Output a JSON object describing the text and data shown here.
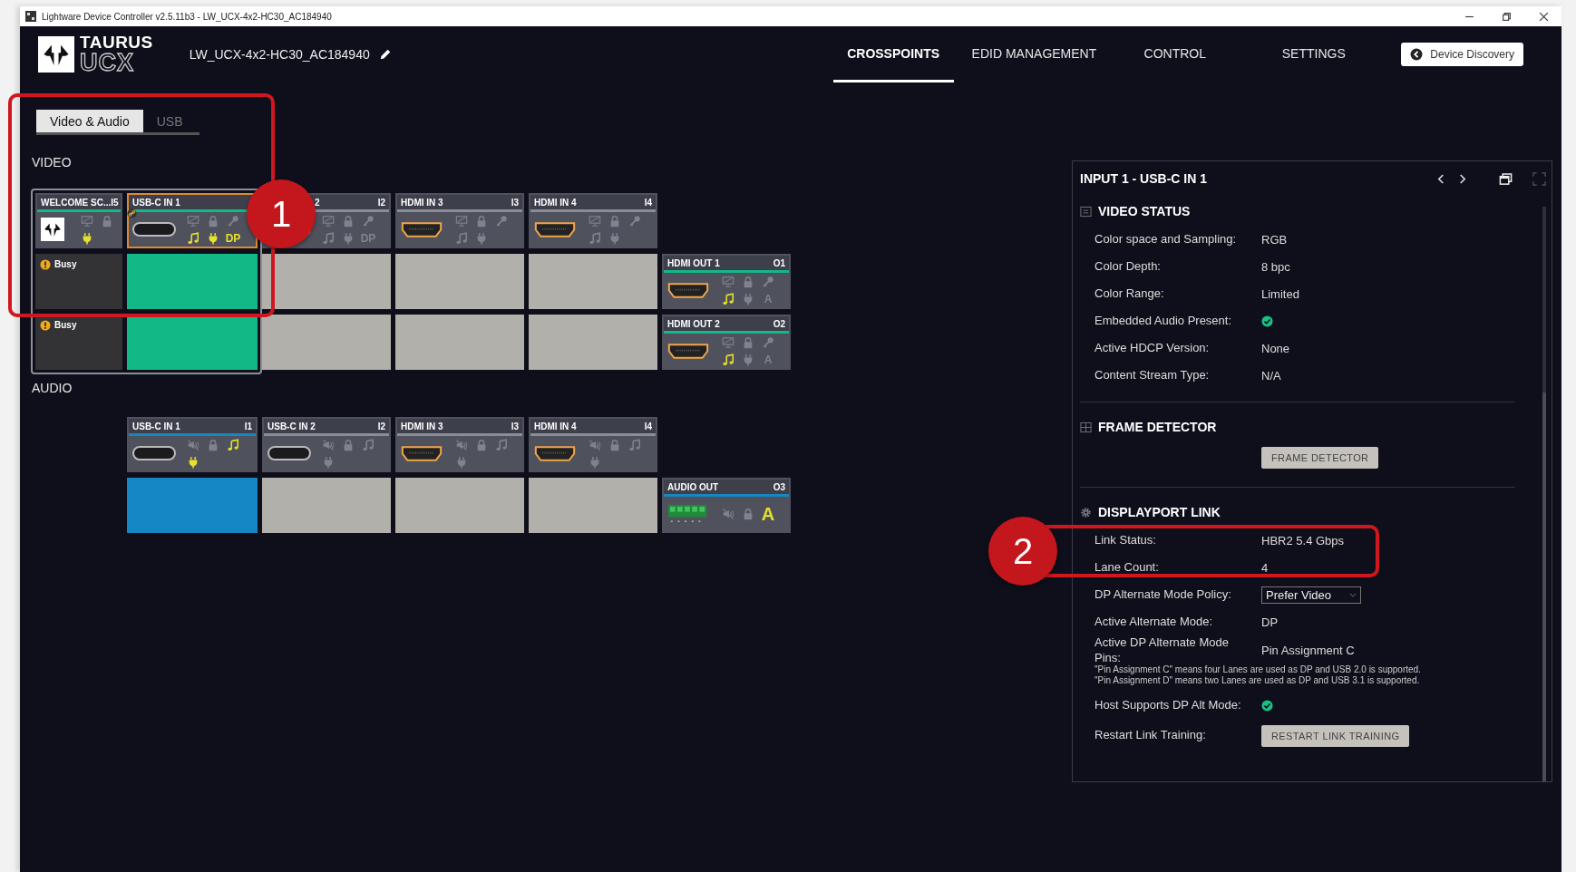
{
  "window": {
    "title": "Lightware Device Controller v2.5.11b3 - LW_UCX-4x2-HC30_AC184940"
  },
  "header": {
    "logo_top": "TAURUS",
    "logo_bottom": "UCX",
    "device_name": "LW_UCX-4x2-HC30_AC184940",
    "nav": [
      {
        "label": "CROSSPOINTS",
        "selected": true
      },
      {
        "label": "EDID MANAGEMENT",
        "selected": false
      },
      {
        "label": "CONTROL",
        "selected": false
      },
      {
        "label": "SETTINGS",
        "selected": false
      }
    ],
    "discovery_button": "Device Discovery"
  },
  "tabs": [
    {
      "label": "Video & Audio",
      "selected": true
    },
    {
      "label": "USB",
      "selected": false
    }
  ],
  "video": {
    "kind": "video",
    "label": "VIDEO",
    "inputs": [
      {
        "name": "WELCOME SC...",
        "port": "I5",
        "kind": "logo",
        "signal": true,
        "selected": false,
        "linked": false,
        "top": [
          {
            "kind": "monitor",
            "active": false
          },
          {
            "kind": "lock",
            "active": false
          }
        ],
        "bottom": [
          {
            "kind": "plug",
            "active": true
          }
        ]
      },
      {
        "name": "USB-C IN 1",
        "kind": "usbc",
        "signal": true,
        "selected": true,
        "linked": true,
        "top": [
          {
            "kind": "monitor",
            "active": false
          },
          {
            "kind": "lock",
            "active": false
          },
          {
            "kind": "key",
            "active": false
          }
        ],
        "bottom": [
          {
            "kind": "music",
            "active": true
          },
          {
            "kind": "plug",
            "active": true
          },
          {
            "kind": "text",
            "text": "DP",
            "active": true
          }
        ]
      },
      {
        "name": "2",
        "port": "I2",
        "kind": "usbc",
        "signal": false,
        "selected": false,
        "linked": false,
        "partly_hidden": true,
        "top": [
          {
            "kind": "monitor",
            "active": false
          },
          {
            "kind": "lock",
            "active": false
          },
          {
            "kind": "key",
            "active": false
          }
        ],
        "bottom": [
          {
            "kind": "music",
            "active": false
          },
          {
            "kind": "plug",
            "active": false
          },
          {
            "kind": "text",
            "text": "DP",
            "active": false
          }
        ]
      },
      {
        "name": "HDMI IN 3",
        "port": "I3",
        "kind": "hdmi",
        "signal": false,
        "selected": false,
        "linked": false,
        "top": [
          {
            "kind": "monitor",
            "active": false
          },
          {
            "kind": "lock",
            "active": false
          },
          {
            "kind": "key",
            "active": false
          }
        ],
        "bottom": [
          {
            "kind": "music",
            "active": false
          },
          {
            "kind": "plug",
            "active": false
          }
        ]
      },
      {
        "name": "HDMI IN 4",
        "port": "I4",
        "kind": "hdmi",
        "signal": false,
        "selected": false,
        "linked": false,
        "top": [
          {
            "kind": "monitor",
            "active": false
          },
          {
            "kind": "lock",
            "active": false
          },
          {
            "kind": "key",
            "active": false
          }
        ],
        "bottom": [
          {
            "kind": "music",
            "active": false
          },
          {
            "kind": "plug",
            "active": false
          }
        ]
      }
    ],
    "outputs": [
      {
        "name": "HDMI OUT 1",
        "port": "O1",
        "kind": "hdmi",
        "signal": true,
        "top": [
          {
            "kind": "monitor",
            "active": false
          },
          {
            "kind": "lock",
            "active": false
          },
          {
            "kind": "key",
            "active": false
          }
        ],
        "bottom": [
          {
            "kind": "music",
            "active": true
          },
          {
            "kind": "plug",
            "active": false
          },
          {
            "kind": "text",
            "text": "A",
            "active": false
          }
        ]
      },
      {
        "name": "HDMI OUT 2",
        "port": "O2",
        "kind": "hdmi",
        "signal": true,
        "top": [
          {
            "kind": "monitor",
            "active": false
          },
          {
            "kind": "lock",
            "active": false
          },
          {
            "kind": "key",
            "active": false
          }
        ],
        "bottom": [
          {
            "kind": "music",
            "active": true
          },
          {
            "kind": "plug",
            "active": false
          },
          {
            "kind": "text",
            "text": "A",
            "active": false
          }
        ]
      }
    ],
    "rows": [
      {
        "cells": [
          {
            "kind": "busy",
            "text": "Busy"
          },
          {
            "kind": "on"
          },
          {
            "kind": "off"
          },
          {
            "kind": "off"
          },
          {
            "kind": "off"
          }
        ]
      },
      {
        "cells": [
          {
            "kind": "busy",
            "text": "Busy"
          },
          {
            "kind": "on"
          },
          {
            "kind": "off"
          },
          {
            "kind": "off"
          },
          {
            "kind": "off"
          }
        ]
      }
    ]
  },
  "audio": {
    "kind": "audio",
    "label": "AUDIO",
    "inputs": [
      {
        "name": "USB-C IN 1",
        "port": "I1",
        "kind": "usbc",
        "signal": true,
        "selected": false,
        "linked": false,
        "top": [
          {
            "kind": "mute",
            "active": false
          },
          {
            "kind": "lock",
            "active": false
          },
          {
            "kind": "music",
            "active": true
          }
        ],
        "bottom": [
          {
            "kind": "plug",
            "active": true
          }
        ]
      },
      {
        "name": "USB-C IN 2",
        "port": "I2",
        "kind": "usbc",
        "signal": false,
        "selected": false,
        "linked": false,
        "top": [
          {
            "kind": "mute",
            "active": false
          },
          {
            "kind": "lock",
            "active": false
          },
          {
            "kind": "music",
            "active": false
          }
        ],
        "bottom": [
          {
            "kind": "plug",
            "active": false
          }
        ]
      },
      {
        "name": "HDMI IN 3",
        "port": "I3",
        "kind": "hdmi",
        "signal": false,
        "selected": false,
        "linked": false,
        "top": [
          {
            "kind": "mute",
            "active": false
          },
          {
            "kind": "lock",
            "active": false
          },
          {
            "kind": "music",
            "active": false
          }
        ],
        "bottom": [
          {
            "kind": "plug",
            "active": false
          }
        ]
      },
      {
        "name": "HDMI IN 4",
        "port": "I4",
        "kind": "hdmi",
        "signal": false,
        "selected": false,
        "linked": false,
        "top": [
          {
            "kind": "mute",
            "active": false
          },
          {
            "kind": "lock",
            "active": false
          },
          {
            "kind": "music",
            "active": false
          }
        ],
        "bottom": [
          {
            "kind": "plug",
            "active": false
          }
        ]
      }
    ],
    "outputs": [
      {
        "name": "AUDIO OUT",
        "port": "O3",
        "kind": "terminal",
        "signal": true,
        "top": [
          {
            "kind": "mute",
            "active": false
          },
          {
            "kind": "lock",
            "active": false
          },
          {
            "kind": "text",
            "text": "A",
            "active": true
          }
        ]
      }
    ],
    "rows": [
      {
        "cells": [
          {
            "kind": "on"
          },
          {
            "kind": "off"
          },
          {
            "kind": "off"
          },
          {
            "kind": "off"
          }
        ]
      }
    ]
  },
  "panel": {
    "title": "INPUT 1 - USB-C IN 1",
    "sections": [
      {
        "title": "VIDEO STATUS",
        "kind": "minus-box",
        "rows": [
          {
            "kind": "text",
            "label": "Color space and Sampling:",
            "value": "RGB"
          },
          {
            "kind": "text",
            "label": "Color Depth:",
            "value": "8 bpc"
          },
          {
            "kind": "text",
            "label": "Color Range:",
            "value": "Limited"
          },
          {
            "kind": "check",
            "label": "Embedded Audio Present:",
            "checked": true
          },
          {
            "kind": "text",
            "label": "Active HDCP Version:",
            "value": "None"
          },
          {
            "kind": "text",
            "label": "Content Stream Type:",
            "value": "N/A"
          }
        ]
      },
      {
        "title": "FRAME DETECTOR",
        "kind": "plus-box",
        "rows": [
          {
            "kind": "button",
            "button": "FRAME DETECTOR"
          }
        ]
      },
      {
        "title": "DISPLAYPORT LINK",
        "kind": "gear",
        "rows": [
          {
            "kind": "text",
            "label": "Link Status:",
            "value": "HBR2 5.4 Gbps"
          },
          {
            "kind": "text",
            "label": "Lane Count:",
            "value": "4"
          },
          {
            "kind": "select",
            "label": "DP Alternate Mode Policy:",
            "value": "Prefer Video"
          },
          {
            "kind": "text",
            "label": "Active Alternate Mode:",
            "value": "DP"
          },
          {
            "kind": "text",
            "label": "Active DP Alternate Mode Pins:",
            "value": "Pin Assignment C"
          },
          {
            "kind": "note",
            "lines": [
              "\"Pin Assignment C\" means four Lanes are used as DP and USB 2.0 is supported.",
              "\"Pin Assignment D\" means two Lanes are used as DP and USB 3.1 is supported."
            ]
          },
          {
            "kind": "check",
            "label": "Host Supports DP Alt Mode:",
            "checked": true
          },
          {
            "kind": "button",
            "label": "Restart Link Training:",
            "button": "RESTART LINK TRAINING"
          }
        ]
      }
    ]
  },
  "callouts": [
    {
      "number": "1"
    },
    {
      "number": "2"
    }
  ]
}
